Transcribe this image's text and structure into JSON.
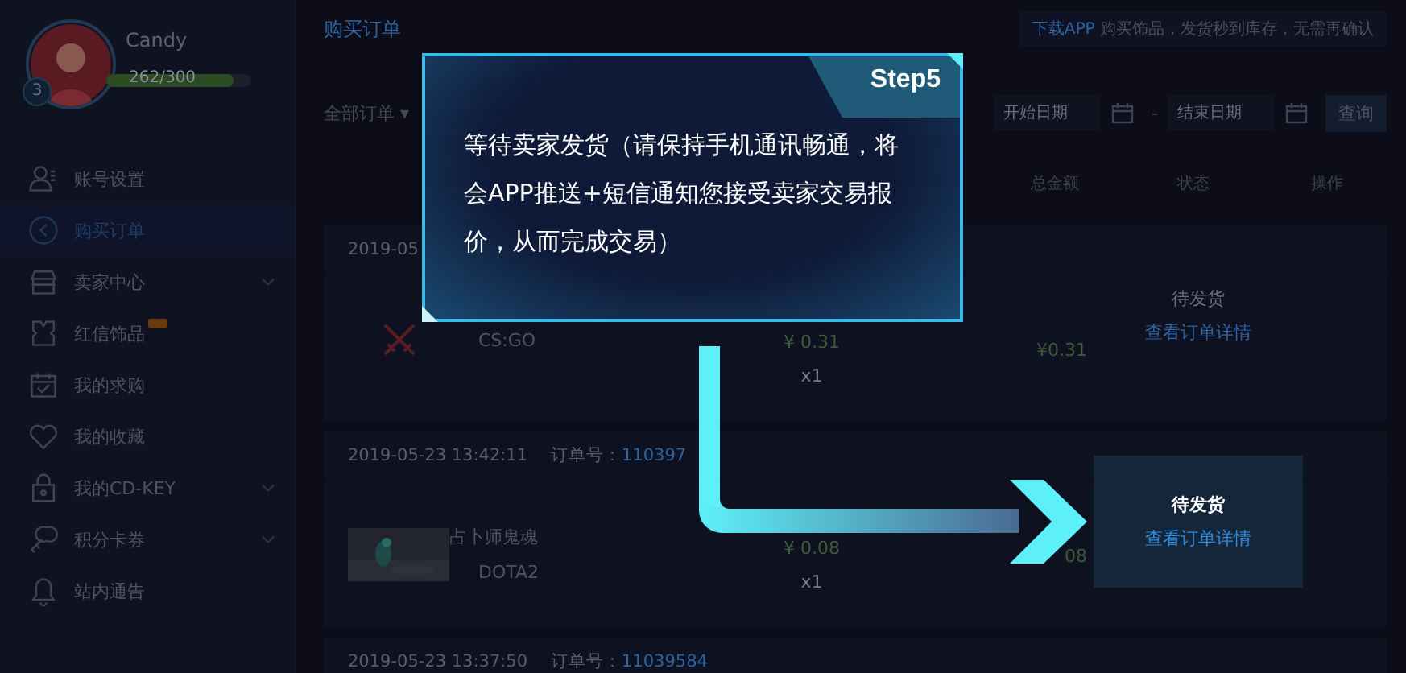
{
  "sidebar": {
    "user": {
      "name": "Candy",
      "level_badge": "3",
      "exp": "262/300",
      "level": 0.873
    },
    "items": [
      {
        "label": "账号设置",
        "selected": false,
        "expandable": false,
        "new_badge": false
      },
      {
        "label": "购买订单",
        "selected": true,
        "expandable": false,
        "new_badge": false
      },
      {
        "label": "卖家中心",
        "selected": false,
        "expandable": true,
        "new_badge": false
      },
      {
        "label": "红信饰品",
        "selected": false,
        "expandable": false,
        "new_badge": true
      },
      {
        "label": "我的求购",
        "selected": false,
        "expandable": false,
        "new_badge": false
      },
      {
        "label": "我的收藏",
        "selected": false,
        "expandable": false,
        "new_badge": false
      },
      {
        "label": "我的CD-KEY",
        "selected": false,
        "expandable": true,
        "new_badge": false
      },
      {
        "label": "积分卡券",
        "selected": false,
        "expandable": true,
        "new_badge": false
      },
      {
        "label": "站内通告",
        "selected": false,
        "expandable": false,
        "new_badge": false
      }
    ]
  },
  "main": {
    "title": "购买订单",
    "notice": {
      "link": "下载APP",
      "text": "购买饰品，发货秒到库存，无需再确认"
    },
    "filter": {
      "status": "全部订单 ▾",
      "start_placeholder": "开始日期",
      "separator": "-",
      "end_placeholder": "结束日期",
      "search_button": "查询"
    },
    "columns": [
      "总金额",
      "状态",
      "操作"
    ],
    "orders": [
      {
        "date": "2019-05",
        "game": "CS:GO",
        "price": "¥ 0.31",
        "qty": "x1",
        "total": "¥0.31",
        "status": "待发货",
        "action": "查看订单详情",
        "highlighted": false,
        "kind": "icon"
      },
      {
        "date": "2019-05-23 13:42:11",
        "order_label": "订单号：",
        "order_no": "110397",
        "name": "占卜师鬼魂",
        "game": "DOTA2",
        "price": "¥ 0.08",
        "qty": "x1",
        "total": "08",
        "status": "待发货",
        "action": "查看订单详情",
        "highlighted": true,
        "kind": "picture"
      },
      {
        "date": "2019-05-23 13:37:50",
        "order_label": "订单号：",
        "order_no": "11039584"
      }
    ]
  },
  "tutorial": {
    "step": "Step5",
    "text": "等待卖家发货（请保持手机通讯畅通，将会APP推送+短信通知您接受卖家交易报价，从而完成交易）"
  }
}
